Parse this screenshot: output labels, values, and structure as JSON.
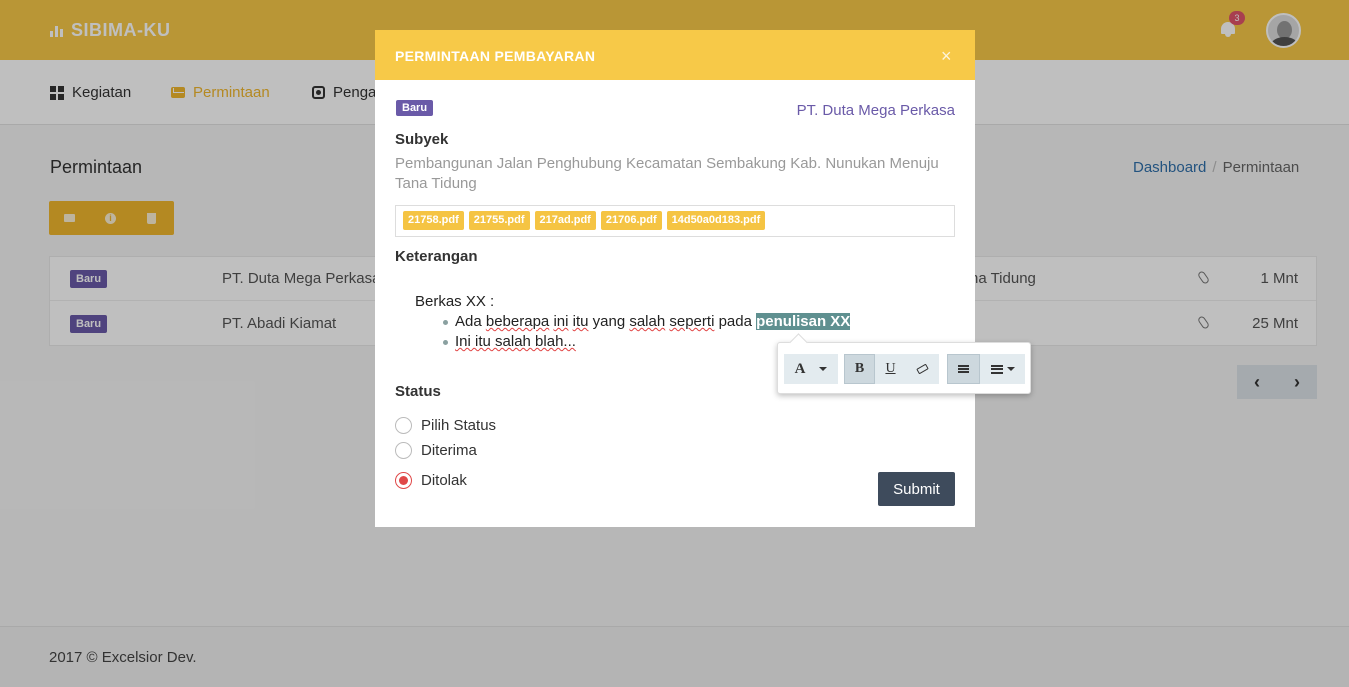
{
  "app": {
    "brand": "SIBIMA-KU",
    "notification_count": "3"
  },
  "nav": {
    "items": [
      {
        "label": "Kegiatan",
        "icon": "dashboard-icon"
      },
      {
        "label": "Permintaan",
        "icon": "envelope-icon",
        "active": true
      },
      {
        "label": "Penga",
        "icon": "cog-icon"
      }
    ]
  },
  "page": {
    "title": "Permintaan"
  },
  "breadcrumb": {
    "home": "Dashboard",
    "separator": "/",
    "current": "Permintaan"
  },
  "table": {
    "rows": [
      {
        "status": "Baru",
        "company": "PT. Duta Mega Perkasa",
        "subject_tail": "na Tidung",
        "time": "1 Mnt"
      },
      {
        "status": "Baru",
        "company": "PT. Abadi Kiamat",
        "subject_tail": "",
        "time": "25 Mnt"
      }
    ]
  },
  "modal": {
    "title": "PERMINTAAN PEMBAYARAN",
    "close": "×",
    "status_badge": "Baru",
    "company": "PT. Duta Mega Perkasa",
    "subject_label": "Subyek",
    "subject": "Pembangunan Jalan Penghubung Kecamatan Sembakung Kab. Nunukan Menuju Tana Tidung",
    "files": [
      "21758.pdf",
      "21755.pdf",
      "217ad.pdf",
      "21706.pdf",
      "14d50a0d183.pdf"
    ],
    "notes_label": "Keterangan",
    "notes": {
      "heading": "Berkas XX :",
      "item1_a": "Ada ",
      "item1_b": "beberapa",
      "item1_c": " ",
      "item1_d": "ini",
      "item1_e": " ",
      "item1_f": "itu",
      "item1_g": " yang ",
      "item1_h": "salah",
      "item1_i": " ",
      "item1_j": "seperti",
      "item1_k": " ",
      "item1_l": "pada",
      "item1_m": " ",
      "item1_highlight": "penulisan XX",
      "item2": "Ini itu salah blah..."
    },
    "status_label": "Status",
    "status_options": [
      "Pilih Status",
      "Diterima",
      "Ditolak"
    ],
    "selected_status": "Ditolak",
    "submit": "Submit"
  },
  "toolbar": {
    "font": "A",
    "bold": "B",
    "underline": "U"
  },
  "pager": {
    "prev": "‹",
    "next": "›"
  },
  "footer": {
    "text": "2017 © Excelsior Dev."
  },
  "colors": {
    "brand": "#f7c948",
    "badge": "#6a5aa8",
    "submit": "#3e4b5c",
    "radio_selected": "#e04848"
  }
}
